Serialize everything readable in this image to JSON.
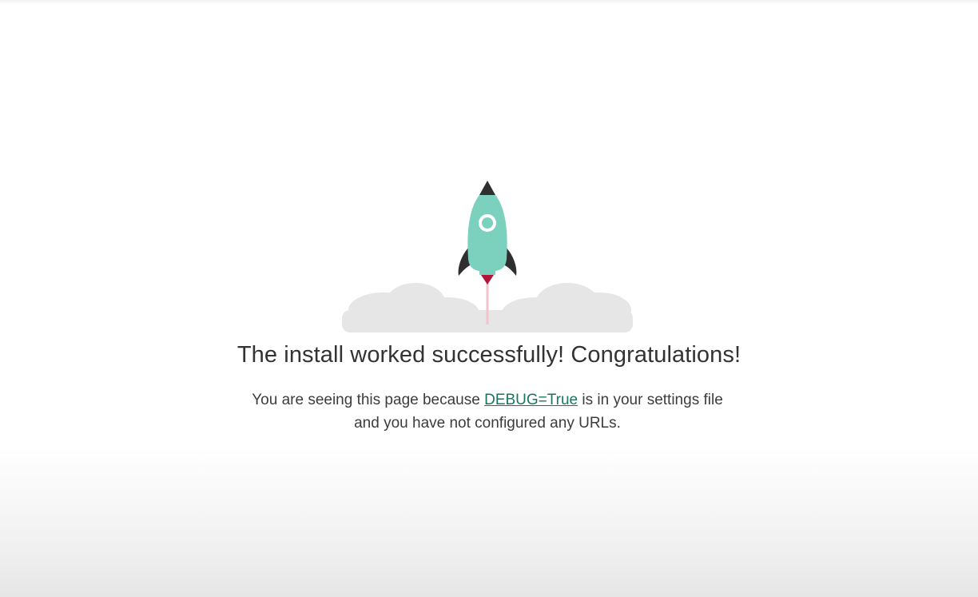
{
  "headline": "The install worked successfully! Congratulations!",
  "message": {
    "before_link": "You are seeing this page because ",
    "link_text": "DEBUG=True",
    "after_link": " is in your settings file and you have not configured any URLs."
  },
  "illustration": {
    "icon": "rocket-launch-icon",
    "colors": {
      "rocket_body": "#7bd1bd",
      "rocket_fins": "#2f2f2f",
      "rocket_flame": "#b3143c",
      "smoke": "#e6e6e6"
    }
  },
  "colors": {
    "link": "#1a7560",
    "text": "#333333"
  }
}
